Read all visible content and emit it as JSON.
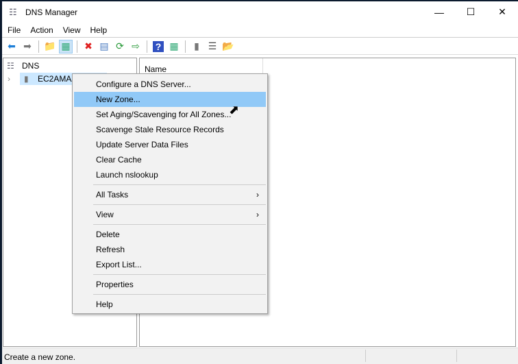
{
  "window": {
    "title": "DNS Manager",
    "minimize": "—",
    "maximize": "☐",
    "close": "✕"
  },
  "menubar": [
    "File",
    "Action",
    "View",
    "Help"
  ],
  "toolbar": [
    {
      "icon": "back-arrow-icon",
      "glyph": "⬅",
      "color": "#1e7fd8"
    },
    {
      "icon": "forward-arrow-icon",
      "glyph": "➡",
      "color": "#777777"
    },
    {
      "icon": "up-folder-icon",
      "glyph": "📁",
      "color": "#d8a82e"
    },
    {
      "icon": "show-hide-tree-icon",
      "glyph": "▦",
      "color": "#3a7",
      "active": true
    },
    {
      "icon": "delete-icon",
      "glyph": "✖",
      "color": "#e02020"
    },
    {
      "icon": "properties-icon",
      "glyph": "▤",
      "color": "#4a7ac0"
    },
    {
      "icon": "refresh-icon",
      "glyph": "⟳",
      "color": "#2a9a3a"
    },
    {
      "icon": "export-list-icon",
      "glyph": "⇨",
      "color": "#2a9a3a"
    },
    {
      "icon": "help-icon",
      "glyph": "?",
      "color": "#ffffff"
    },
    {
      "icon": "action-pane-icon",
      "glyph": "▦",
      "color": "#3a7"
    },
    {
      "icon": "server-icon",
      "glyph": "▮",
      "color": "#777777"
    },
    {
      "icon": "list-icon",
      "glyph": "☰",
      "color": "#555555"
    },
    {
      "icon": "zone-folder-icon",
      "glyph": "📂",
      "color": "#d8a82e"
    }
  ],
  "tree": {
    "root": "DNS",
    "server": "EC2AMAZ-"
  },
  "list": {
    "column": "Name"
  },
  "context_menu": [
    {
      "label": "Configure a DNS Server..."
    },
    {
      "label": "New Zone...",
      "highlighted": true
    },
    {
      "label": "Set Aging/Scavenging for All Zones..."
    },
    {
      "label": "Scavenge Stale Resource Records"
    },
    {
      "label": "Update Server Data Files"
    },
    {
      "label": "Clear Cache"
    },
    {
      "label": "Launch nslookup"
    },
    {
      "separator": true
    },
    {
      "label": "All Tasks",
      "submenu": true
    },
    {
      "separator": true
    },
    {
      "label": "View",
      "submenu": true
    },
    {
      "separator": true
    },
    {
      "label": "Delete"
    },
    {
      "label": "Refresh"
    },
    {
      "label": "Export List..."
    },
    {
      "separator": true
    },
    {
      "label": "Properties"
    },
    {
      "separator": true
    },
    {
      "label": "Help"
    }
  ],
  "status": {
    "text": "Create a new zone."
  }
}
